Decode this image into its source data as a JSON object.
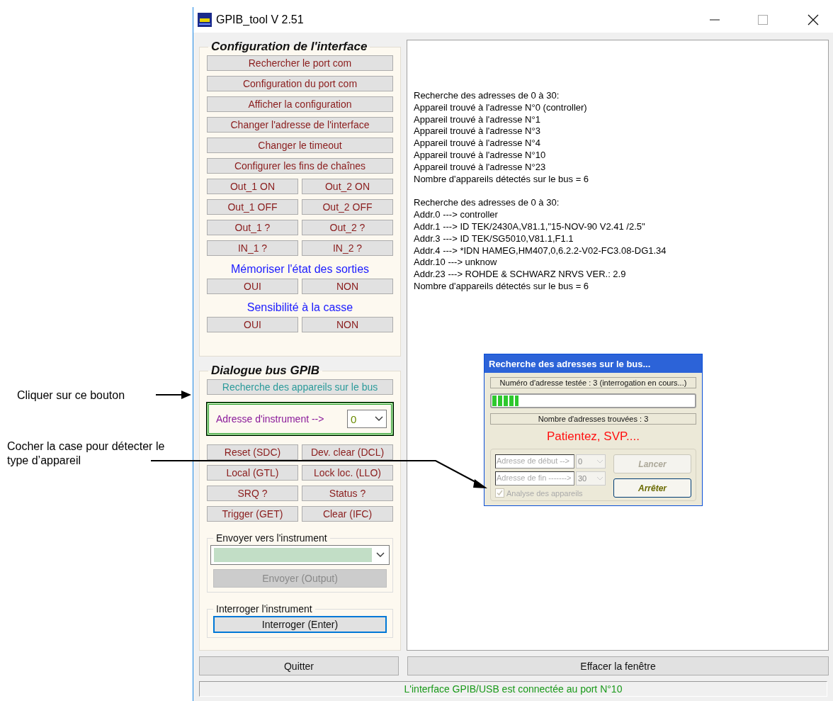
{
  "annotations": [
    {
      "text": "Cliquer sur ce bouton"
    },
    {
      "text": "Cocher la case pour détecter le type d’appareil"
    }
  ],
  "window": {
    "title": "GPIB_tool V 2.51"
  },
  "config": {
    "title": "Configuration de l'interface",
    "items": [
      {
        "kind": "button",
        "label": "Rechercher le port com"
      },
      {
        "kind": "button",
        "label": "Configuration du port com"
      },
      {
        "kind": "button",
        "label": "Afficher la configuration"
      },
      {
        "kind": "button",
        "label": "Changer l'adresse de l'interface"
      },
      {
        "kind": "button",
        "label": "Changer le timeout"
      },
      {
        "kind": "button",
        "label": "Configurer les  fins de chaînes"
      },
      {
        "kind": "pair",
        "labels": [
          "Out_1 ON",
          "Out_2 ON"
        ]
      },
      {
        "kind": "pair",
        "labels": [
          "Out_1 OFF",
          "Out_2 OFF"
        ]
      },
      {
        "kind": "pair",
        "labels": [
          "Out_1 ?",
          "Out_2 ?"
        ]
      },
      {
        "kind": "pair",
        "labels": [
          "IN_1 ?",
          "IN_2 ?"
        ]
      },
      {
        "kind": "heading",
        "label": "Mémoriser l'état des sorties"
      },
      {
        "kind": "pair",
        "labels": [
          "OUI",
          "NON"
        ]
      },
      {
        "kind": "heading",
        "label": "Sensibilité à la casse"
      },
      {
        "kind": "pair",
        "labels": [
          "OUI",
          "NON"
        ]
      }
    ]
  },
  "dialogue": {
    "title": "Dialogue bus GPIB",
    "search_button": "Recherche des appareils sur le bus",
    "address": {
      "label": "Adresse d'instrument -->",
      "value": "0"
    },
    "pairs": [
      [
        "Reset (SDC)",
        "Dev. clear (DCL)"
      ],
      [
        "Local (GTL)",
        "Lock loc. (LLO)"
      ],
      [
        "SRQ ?",
        "Status ?"
      ],
      [
        "Trigger (GET)",
        "Clear (IFC)"
      ]
    ],
    "send": {
      "legend": "Envoyer vers l'instrument",
      "button": "Envoyer (Output)",
      "disabled": true
    },
    "query": {
      "legend": "Interroger l'instrument",
      "button": "Interroger (Enter)",
      "focused": true
    }
  },
  "log": {
    "blocks": [
      [
        "Recherche des adresses de 0 à 30:",
        "Appareil trouvé à l'adresse N°0 (controller)",
        "Appareil trouvé à l'adresse N°1",
        "Appareil trouvé à l'adresse N°3",
        "Appareil trouvé à l'adresse N°4",
        "Appareil trouvé à l'adresse N°10",
        "Appareil trouvé à l'adresse N°23",
        "Nombre d'appareils détectés sur le bus = 6"
      ],
      [
        "Recherche des adresses de 0 à 30:",
        "Addr.0 ---> controller",
        "Addr.1 ---> ID TEK/2430A,V81.1,\"15-NOV-90  V2.41 /2.5\"",
        "Addr.3 ---> ID TEK/SG5010,V81.1,F1.1",
        "Addr.4 ---> *IDN HAMEG,HM407,0,6.2.2-V02-FC3.08-DG1.34",
        "Addr.10 ---> unknow",
        "Addr.23 ---> ROHDE & SCHWARZ NRVS VER.: 2.9",
        "Nombre d'appareils détectés sur le bus = 6"
      ]
    ]
  },
  "popup": {
    "title": "Recherche des adresses sur le bus...",
    "status": "Numéro d'adresse testée : 3 (interrogation en cours...)",
    "progress": {
      "level": 0.13
    },
    "found": "Nombre d'adresses trouvées : 3",
    "wait": "Patientez, SVP....",
    "start": {
      "label": "Adresse de début -->",
      "value": "0"
    },
    "end": {
      "label": "Adresse de fin ------->",
      "value": "30"
    },
    "checkbox": {
      "label": "Analyse des appareils",
      "checked": true,
      "disabled": true
    },
    "buttons": [
      {
        "label": "Lancer",
        "disabled": true
      },
      {
        "label": "Arrêter",
        "disabled": false
      }
    ]
  },
  "bottom_buttons": [
    "Quitter",
    "Effacer la fenêtre"
  ],
  "status_bar": "L'interface GPIB/USB est connectée au port N°10"
}
